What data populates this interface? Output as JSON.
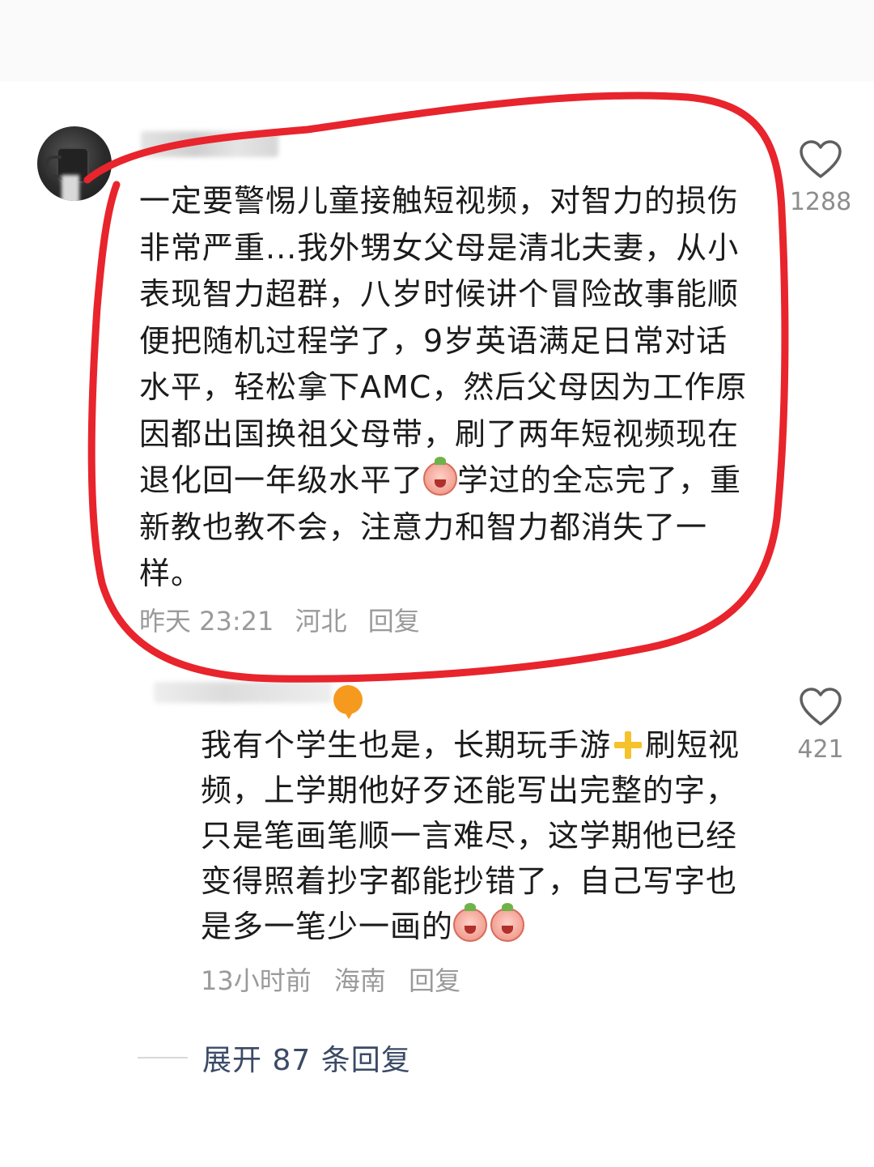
{
  "comment": {
    "text_part1": "一定要警惕儿童接触短视频，对智力的损伤非常严重...我外甥女父母是清北夫妻，从小表现智力超群，八岁时候讲个冒险故事能顺便把随机过程学了，9岁英语满足日常对话水平，轻松拿下AMC，然后父母因为工作原因都出国换祖父母带，刷了两年短视频现在退化回一年级水平了",
    "text_part2": "学过的全忘完了，重新教也教不会，注意力和智力都消失了一样。",
    "time": "昨天 23:21",
    "location": "河北",
    "reply_label": "回复",
    "like_count": "1288",
    "emoji_name": "crying-emoji"
  },
  "reply": {
    "text_part1": "我有个学生也是，长期玩手游",
    "text_part2": "刷短视频，上学期他好歹还能写出完整的字，只是笔画笔顺一言难尽，这学期他已经变得照着抄字都能抄错了，自己写字也是多一笔少一画的",
    "time": "13小时前",
    "location": "海南",
    "reply_label": "回复",
    "like_count": "421"
  },
  "expand": {
    "label": "展开 87 条回复"
  },
  "colors": {
    "annotation": "#e8242c",
    "text": "#1b1b1b",
    "meta": "#9a9a9a",
    "expand_link": "#3b4a66"
  }
}
